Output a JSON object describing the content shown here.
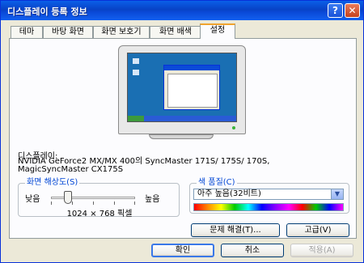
{
  "window": {
    "title": "디스플레이 등록 정보",
    "help_label": "?",
    "close_label": "✕"
  },
  "tabs": [
    {
      "label": "테마"
    },
    {
      "label": "바탕 화면"
    },
    {
      "label": "화면 보호기"
    },
    {
      "label": "화면 배색"
    },
    {
      "label": "설정",
      "active": true
    }
  ],
  "display": {
    "label": "디스플레이:",
    "value": "NVIDIA GeForce2 MX/MX 400의 SyncMaster 171S/ 175S/ 170S, MagicSyncMaster CX175S"
  },
  "resolution": {
    "group_label": "화면 해상도(S)",
    "low_label": "낮음",
    "high_label": "높음",
    "value_text": "1024 × 768 픽셀",
    "slider_position": 0.2
  },
  "color": {
    "group_label": "색 품질(C)",
    "selected": "아주 높음(32비트)"
  },
  "buttons": {
    "troubleshoot": "문제 해결(T)...",
    "advanced": "고급(V)",
    "ok": "확인",
    "cancel": "취소",
    "apply": "적용(A)"
  }
}
